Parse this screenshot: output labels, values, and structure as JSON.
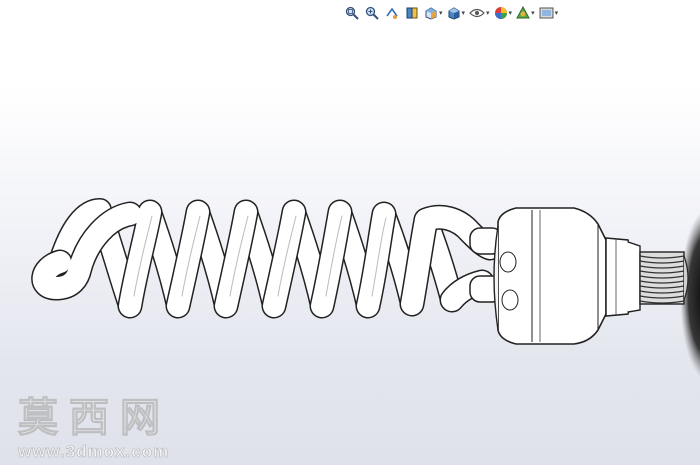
{
  "hud_toolbar": {
    "buttons": [
      {
        "name": "zoom-to-fit-icon",
        "has_menu": false
      },
      {
        "name": "zoom-to-area-icon",
        "has_menu": false
      },
      {
        "name": "previous-view-icon",
        "has_menu": false
      },
      {
        "name": "section-view-icon",
        "has_menu": false
      },
      {
        "name": "view-orientation-icon",
        "has_menu": true
      },
      {
        "name": "display-style-icon",
        "has_menu": true
      },
      {
        "name": "hide-show-items-icon",
        "has_menu": true
      },
      {
        "name": "edit-appearance-icon",
        "has_menu": true
      },
      {
        "name": "apply-scene-icon",
        "has_menu": true
      },
      {
        "name": "view-settings-icon",
        "has_menu": true
      }
    ],
    "caret": "▾"
  },
  "model": {
    "description_icon": "spiral-cfl-bulb",
    "shaded_with_edges": true
  },
  "watermark": {
    "title": "莫西网",
    "url": "www.3dmox.com"
  },
  "colors": {
    "background_top": "#ffffff",
    "background_bottom": "#dfe2ea",
    "model_fill": "#ffffff",
    "model_edge": "#222222"
  }
}
